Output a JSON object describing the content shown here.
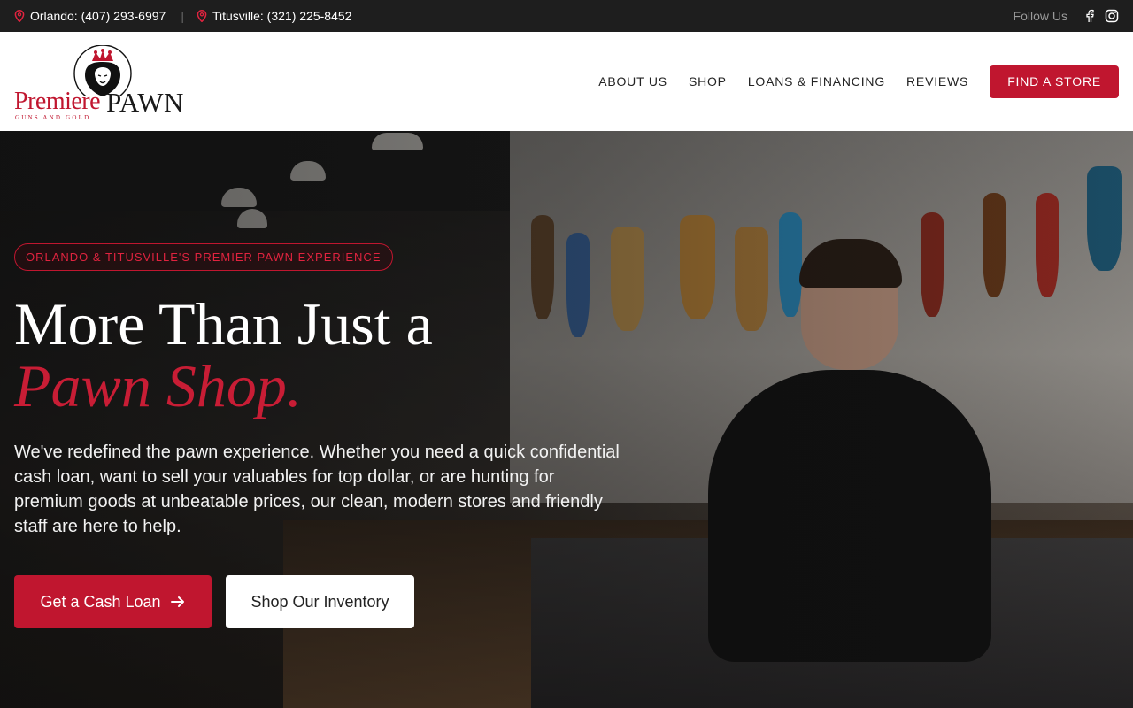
{
  "topbar": {
    "locations": [
      {
        "label": "Orlando: (407) 293-6997",
        "icon": "map-pin-icon"
      },
      {
        "label": "Titusville: (321) 225-8452",
        "icon": "map-pin-icon"
      }
    ],
    "separator": "|",
    "follow_label": "Follow Us",
    "social": [
      "facebook-icon",
      "instagram-icon"
    ]
  },
  "header": {
    "logo": {
      "word1": "Premiere",
      "word2": "PAWN",
      "tagline": "GUNS AND GOLD"
    },
    "nav": [
      {
        "label": "ABOUT US"
      },
      {
        "label": "SHOP"
      },
      {
        "label": "LOANS & FINANCING"
      },
      {
        "label": "REVIEWS"
      }
    ],
    "cta": "FIND A STORE"
  },
  "hero": {
    "badge": "ORLANDO & TITUSVILLE'S PREMIER PAWN EXPERIENCE",
    "title_line1": "More Than Just a",
    "title_line2": "Pawn Shop.",
    "lead": "We've redefined the pawn experience. Whether you need a quick confidential cash loan, want to sell your valuables for top dollar, or are hunting for premium goods at unbeatable prices, our clean, modern stores and friendly staff are here to help.",
    "primary_button": "Get a Cash Loan",
    "secondary_button": "Shop Our Inventory"
  },
  "colors": {
    "accent": "#c0162f",
    "topbar_bg": "#1e1e1e",
    "header_bg": "#ffffff"
  }
}
